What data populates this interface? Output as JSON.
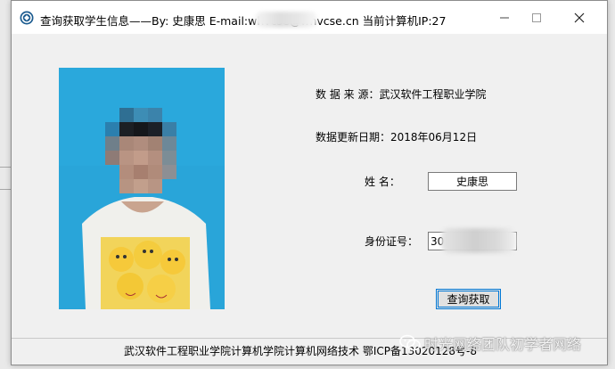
{
  "window": {
    "title": "查询获取学生信息——By:  史康思  E-mail:whvcse@whvcse.cn  当前计算机IP:27",
    "controls": {
      "minimize": "─",
      "maximize": "☐",
      "close": "✕"
    }
  },
  "info": {
    "source_label": "数 据 来 源：武汉软件工程职业学院",
    "update_label": "数据更新日期：2018年06月12日",
    "name_label": "姓      名：",
    "name_value": "史康思",
    "id_label": "身份证号：",
    "id_value": "30"
  },
  "query_button": "查询获取",
  "footer": "武汉软件工程职业学院计算机学院计算机网络技术   鄂ICP备13020128号-8",
  "watermark": "时光网络团队初学者网络",
  "colors": {
    "photo_bg": "#29a5d9",
    "button_border": "#0078d7"
  }
}
